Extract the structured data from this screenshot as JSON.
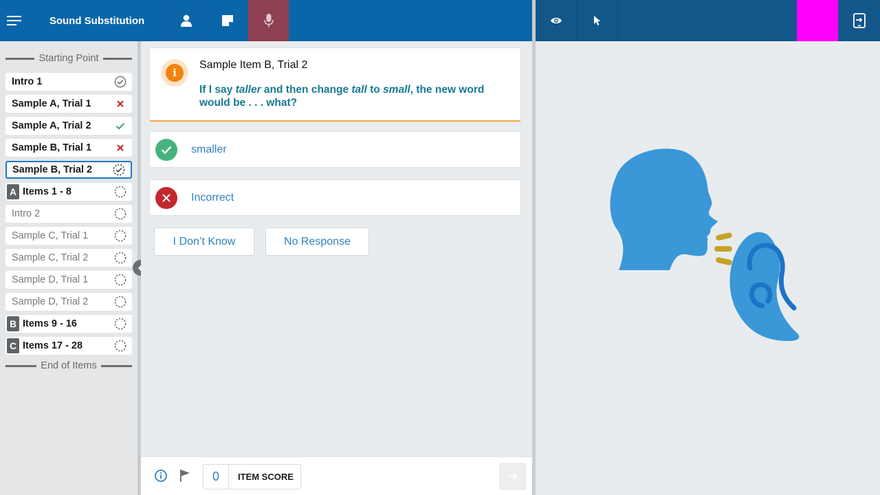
{
  "app": {
    "title": "Sound Substitution"
  },
  "toolbar": {
    "accent_active": "#8e3f52",
    "marker_color": "#ff00ff"
  },
  "sidebar": {
    "start_label": "Starting Point",
    "end_label": "End of Items",
    "items": [
      {
        "label": "Intro 1",
        "status": "done"
      },
      {
        "label": "Sample A, Trial 1",
        "status": "incorrect"
      },
      {
        "label": "Sample A, Trial 2",
        "status": "correct"
      },
      {
        "label": "Sample B, Trial 1",
        "status": "incorrect"
      },
      {
        "label": "Sample B, Trial 2",
        "status": "in-progress"
      },
      {
        "badge": "A",
        "label": "Items 1 - 8",
        "status": "pending"
      },
      {
        "label": "Intro 2",
        "status": "pending"
      },
      {
        "label": "Sample C, Trial 1",
        "status": "pending"
      },
      {
        "label": "Sample C, Trial 2",
        "status": "pending"
      },
      {
        "label": "Sample D, Trial 1",
        "status": "pending"
      },
      {
        "label": "Sample D, Trial 2",
        "status": "pending"
      },
      {
        "badge": "B",
        "label": "Items 9 - 16",
        "status": "pending"
      },
      {
        "badge": "C",
        "label": "Items 17 - 28",
        "status": "pending"
      }
    ]
  },
  "prompt": {
    "title": "Sample Item B, Trial 2",
    "text_parts": [
      "If I say ",
      "taller",
      " and then change ",
      "tall",
      " to ",
      "small",
      ", the new word would be . . . what?"
    ]
  },
  "answers": {
    "correct_label": "smaller",
    "incorrect_label": "Incorrect"
  },
  "buttons": {
    "dont_know": "I Don’t Know",
    "no_response": "No Response"
  },
  "footer": {
    "score_value": "0",
    "score_label": "ITEM SCORE"
  },
  "stimulus": {
    "head_color": "#3a97d8",
    "ear_inner_color": "#1c74c6",
    "sound_lines_color": "#c7a227"
  }
}
